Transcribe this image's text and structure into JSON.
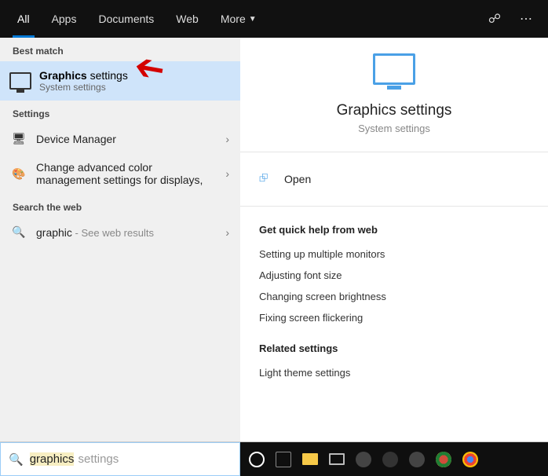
{
  "tabs": {
    "all": "All",
    "apps": "Apps",
    "documents": "Documents",
    "web": "Web",
    "more": "More"
  },
  "left": {
    "bestMatchHdr": "Best match",
    "best": {
      "title": "Graphics settings",
      "boldPart": "Graphics",
      "restPart": " settings",
      "sub": "System settings"
    },
    "settingsHdr": "Settings",
    "settings": [
      {
        "icon": "🖥",
        "label": "Device Manager"
      },
      {
        "icon": "🎨",
        "label": "Change advanced color management settings for displays,"
      }
    ],
    "webHdr": "Search the web",
    "web": {
      "query": "graphic",
      "suffix": " - See web results"
    }
  },
  "right": {
    "title": "Graphics settings",
    "sub": "System settings",
    "open": "Open",
    "quickHdr": "Get quick help from web",
    "quick": [
      "Setting up multiple monitors",
      "Adjusting font size",
      "Changing screen brightness",
      "Fixing screen flickering"
    ],
    "relatedHdr": "Related settings",
    "related": [
      "Light theme settings"
    ]
  },
  "search": {
    "typed": "graphics",
    "suggestion": " settings"
  }
}
